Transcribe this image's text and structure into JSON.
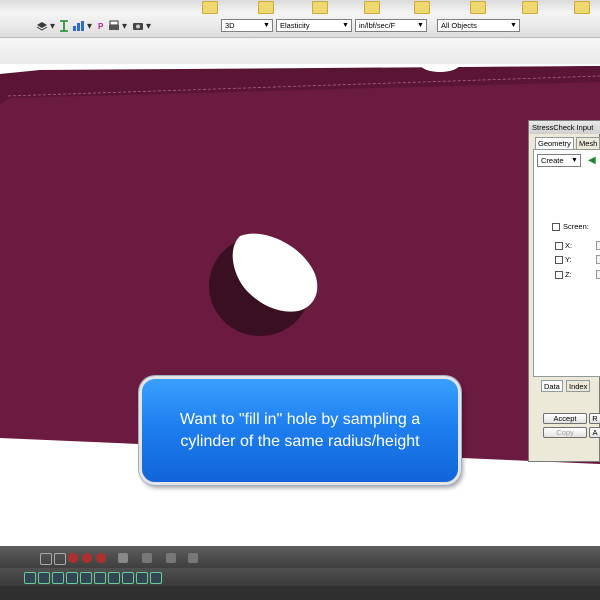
{
  "toolbar": {
    "view_select": "3D",
    "analysis_select": "Elasticity",
    "units_select": "in/lbf/sec/F",
    "objects_select": "All Objects"
  },
  "panel": {
    "title": "StressCheck Input",
    "tabs": [
      "Geometry",
      "Mesh"
    ],
    "action_select": "Create",
    "screen_label": "Screen:",
    "x_label": "X:",
    "y_label": "Y:",
    "z_label": "Z:",
    "bottom_tabs": [
      "Data",
      "Index"
    ],
    "accept_label": "Accept",
    "copy_label": "Copy",
    "r_label": "R",
    "a_label": "A"
  },
  "callout": {
    "line1": "Want to \"fill in\" hole by sampling a",
    "line2": "cylinder of the same radius/height"
  },
  "colors": {
    "model": "#6b1a40",
    "callout": "#1e7ff0",
    "toolbar": "#e6e6e6"
  }
}
